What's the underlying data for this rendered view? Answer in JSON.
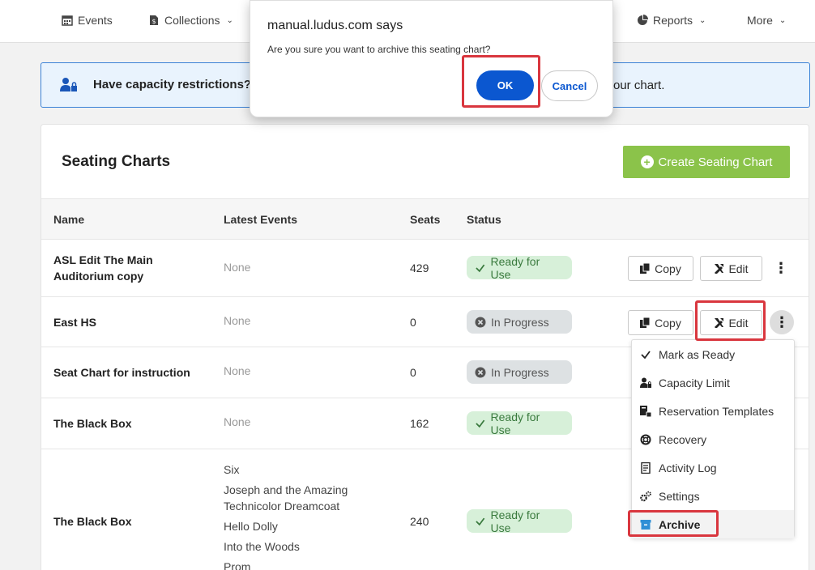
{
  "nav": {
    "events": "Events",
    "collections": "Collections",
    "reports": "Reports",
    "more": "More"
  },
  "banner": {
    "text": "Have capacity restrictions?",
    "tail": "our chart."
  },
  "card": {
    "title": "Seating Charts",
    "create_label": "Create Seating Chart"
  },
  "table": {
    "headers": [
      "Name",
      "Latest Events",
      "Seats",
      "Status"
    ],
    "rows": [
      {
        "name": "ASL Edit The Main Auditorium copy",
        "events": "None",
        "seats": "429",
        "status": "Ready for Use"
      },
      {
        "name": "East HS",
        "events": "None",
        "seats": "0",
        "status": "In Progress"
      },
      {
        "name": "Seat Chart for instruction",
        "events": "None",
        "seats": "0",
        "status": "In Progress"
      },
      {
        "name": "The Black Box",
        "events": "None",
        "seats": "162",
        "status": "Ready for Use"
      },
      {
        "name": "The Black Box",
        "events": [
          "Six",
          "Joseph and the Amazing Technicolor Dreamcoat",
          "Hello Dolly",
          "Into the Woods",
          "Prom"
        ],
        "seats": "240",
        "status": "Ready for Use"
      }
    ],
    "copy_label": "Copy",
    "edit_label": "Edit",
    "kebab_label": "⋮"
  },
  "menu": {
    "items": [
      "Mark as Ready",
      "Capacity Limit",
      "Reservation Templates",
      "Recovery",
      "Activity Log",
      "Settings",
      "Archive"
    ]
  },
  "dialog": {
    "title": "manual.ludus.com says",
    "message": "Are you sure you want to archive this seating chart?",
    "ok": "OK",
    "cancel": "Cancel"
  },
  "colors": {
    "accent_green": "#8bc34a",
    "highlight_red": "#d9363e",
    "dialog_blue": "#0b57d0",
    "ready_bg": "#d7f0d9",
    "progress_bg": "#dde1e3"
  }
}
